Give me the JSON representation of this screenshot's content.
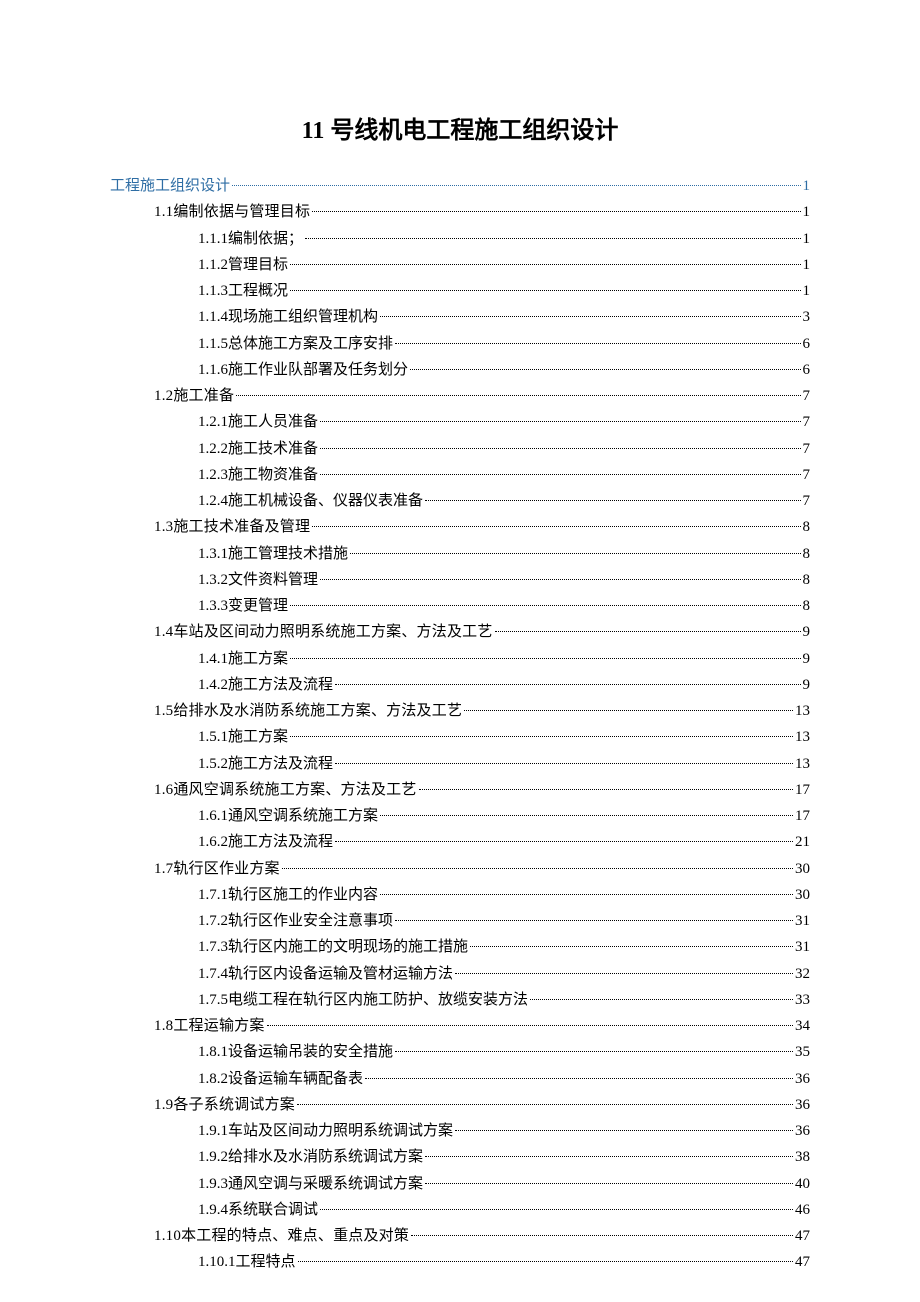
{
  "title": "11 号线机电工程施工组织设计",
  "toc": [
    {
      "lvl": 1,
      "num": "",
      "text": "工程施工组织设计",
      "page": "1"
    },
    {
      "lvl": 2,
      "num": "1.1",
      "text": " 编制依据与管理目标",
      "page": "1"
    },
    {
      "lvl": 3,
      "num": "1.1.1",
      "text": " 编制依据；",
      "page": "1"
    },
    {
      "lvl": 3,
      "num": "1.1.2",
      "text": " 管理目标",
      "page": "1"
    },
    {
      "lvl": 3,
      "num": "1.1.3",
      "text": " 工程概况",
      "page": "1"
    },
    {
      "lvl": 3,
      "num": "1.1.4",
      "text": " 现场施工组织管理机构",
      "page": "3"
    },
    {
      "lvl": 3,
      "num": "1.1.5",
      "text": " 总体施工方案及工序安排",
      "page": "6"
    },
    {
      "lvl": 3,
      "num": "1.1.6",
      "text": " 施工作业队部署及任务划分",
      "page": "6"
    },
    {
      "lvl": 2,
      "num": "1.2",
      "text": " 施工准备",
      "page": "7"
    },
    {
      "lvl": 3,
      "num": "1.2.1",
      "text": " 施工人员准备",
      "page": "7"
    },
    {
      "lvl": 3,
      "num": "1.2.2",
      "text": " 施工技术准备",
      "page": "7"
    },
    {
      "lvl": 3,
      "num": "1.2.3",
      "text": " 施工物资准备",
      "page": "7"
    },
    {
      "lvl": 3,
      "num": "1.2.4",
      "text": " 施工机械设备、仪器仪表准备",
      "page": "7"
    },
    {
      "lvl": 2,
      "num": "1.3",
      "text": " 施工技术准备及管理",
      "page": "8"
    },
    {
      "lvl": 3,
      "num": "1.3.1",
      "text": " 施工管理技术措施",
      "page": "8"
    },
    {
      "lvl": 3,
      "num": "1.3.2",
      "text": " 文件资料管理",
      "page": "8"
    },
    {
      "lvl": 3,
      "num": "1.3.3",
      "text": " 变更管理",
      "page": "8"
    },
    {
      "lvl": 2,
      "num": "1.4",
      "text": " 车站及区间动力照明系统施工方案、方法及工艺",
      "page": "9"
    },
    {
      "lvl": 3,
      "num": "1.4.1",
      "text": " 施工方案",
      "page": "9"
    },
    {
      "lvl": 3,
      "num": "1.4.2",
      "text": " 施工方法及流程",
      "page": "9"
    },
    {
      "lvl": 2,
      "num": "1.5",
      "text": " 给排水及水消防系统施工方案、方法及工艺",
      "page": "13"
    },
    {
      "lvl": 3,
      "num": "1.5.1",
      "text": " 施工方案",
      "page": "13"
    },
    {
      "lvl": 3,
      "num": "1.5.2",
      "text": " 施工方法及流程",
      "page": "13"
    },
    {
      "lvl": 2,
      "num": "1.6",
      "text": " 通风空调系统施工方案、方法及工艺",
      "page": "17"
    },
    {
      "lvl": 3,
      "num": "1.6.1",
      "text": " 通风空调系统施工方案",
      "page": "17"
    },
    {
      "lvl": 3,
      "num": "1.6.2",
      "text": " 施工方法及流程",
      "page": "21"
    },
    {
      "lvl": 2,
      "num": "1.7",
      "text": " 轨行区作业方案",
      "page": "30"
    },
    {
      "lvl": 3,
      "num": "1.7.1",
      "text": " 轨行区施工的作业内容",
      "page": "30"
    },
    {
      "lvl": 3,
      "num": "1.7.2",
      "text": " 轨行区作业安全注意事项",
      "page": "31"
    },
    {
      "lvl": 3,
      "num": "1.7.3",
      "text": " 轨行区内施工的文明现场的施工措施",
      "page": "31"
    },
    {
      "lvl": 3,
      "num": "1.7.4",
      "text": " 轨行区内设备运输及管材运输方法",
      "page": "32"
    },
    {
      "lvl": 3,
      "num": "1.7.5",
      "text": " 电缆工程在轨行区内施工防护、放缆安装方法",
      "page": "33"
    },
    {
      "lvl": 2,
      "num": "1.8",
      "text": " 工程运输方案",
      "page": "34"
    },
    {
      "lvl": 3,
      "num": "1.8.1",
      "text": " 设备运输吊装的安全措施",
      "page": "35"
    },
    {
      "lvl": 3,
      "num": "1.8.2",
      "text": " 设备运输车辆配备表",
      "page": "36"
    },
    {
      "lvl": 2,
      "num": "1.9",
      "text": " 各子系统调试方案",
      "page": "36"
    },
    {
      "lvl": 3,
      "num": "1.9.1",
      "text": " 车站及区间动力照明系统调试方案",
      "page": "36"
    },
    {
      "lvl": 3,
      "num": "1.9.2",
      "text": " 给排水及水消防系统调试方案",
      "page": "38"
    },
    {
      "lvl": 3,
      "num": "1.9.3",
      "text": " 通风空调与采暖系统调试方案",
      "page": "40"
    },
    {
      "lvl": 3,
      "num": "1.9.4",
      "text": " 系统联合调试",
      "page": "46"
    },
    {
      "lvl": 2,
      "num": "1.10",
      "text": " 本工程的特点、难点、重点及对策",
      "page": "47"
    },
    {
      "lvl": 3,
      "num": "1.10.1",
      "text": " 工程特点",
      "page": "47"
    }
  ]
}
